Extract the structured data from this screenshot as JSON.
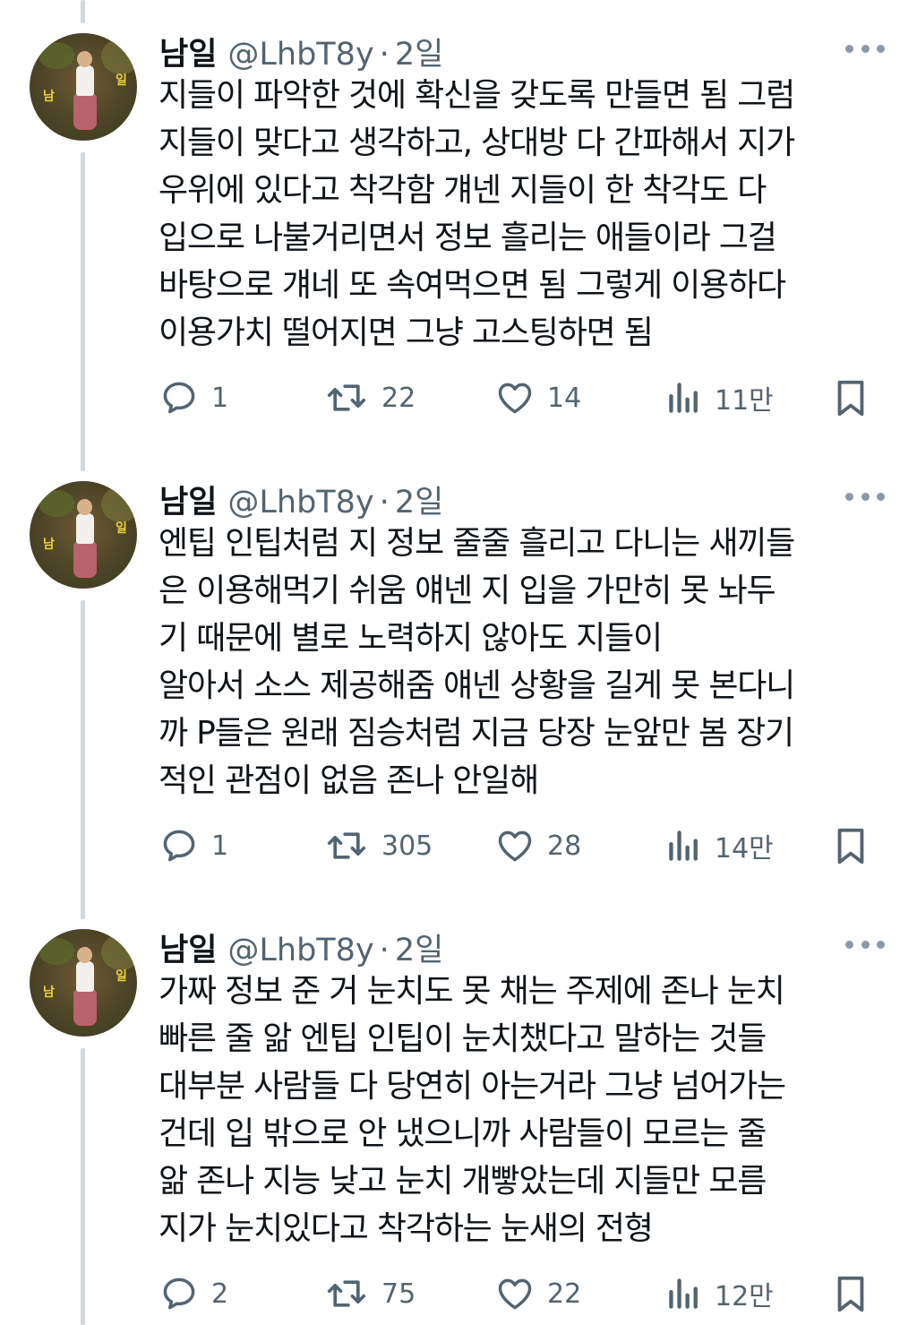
{
  "tweets": [
    {
      "author": "남일",
      "handle": "@LhbT8y",
      "separator": "·",
      "time": "2일",
      "lines": [
        "지들이 파악한 것에 확신을 갖도록 만들면 됨 그럼",
        "지들이 맞다고 생각하고, 상대방 다 간파해서 지가",
        "우위에 있다고 착각함 걔넨 지들이 한 착각도 다",
        "입으로 나불거리면서 정보 흘리는 애들이라 그걸",
        "바탕으로 걔네 또 속여먹으면 됨 그렇게 이용하다",
        "이용가치 떨어지면 그냥 고스팅하면 됨"
      ],
      "replies": "1",
      "retweets": "22",
      "likes": "14",
      "views": "11만"
    },
    {
      "author": "남일",
      "handle": "@LhbT8y",
      "separator": "·",
      "time": "2일",
      "lines": [
        "엔팁 인팁처럼 지 정보 줄줄 흘리고 다니는 새끼들",
        "은 이용해먹기 쉬움 얘넨 지 입을 가만히 못 놔두",
        "기 때문에 별로 노력하지 않아도 지들이",
        "알아서 소스 제공해줌 얘넨 상황을 길게 못 본다니",
        "까 P들은 원래 짐승처럼 지금 당장 눈앞만 봄 장기",
        "적인 관점이 없음 존나 안일해"
      ],
      "replies": "1",
      "retweets": "305",
      "likes": "28",
      "views": "14만"
    },
    {
      "author": "남일",
      "handle": "@LhbT8y",
      "separator": "·",
      "time": "2일",
      "lines": [
        "가짜 정보 준 거 눈치도 못 채는 주제에 존나 눈치",
        "빠른 줄 앎 엔팁 인팁이 눈치챘다고 말하는 것들",
        "대부분 사람들 다 당연히 아는거라 그냥 넘어가는",
        "건데 입 밖으로 안 냈으니까 사람들이 모르는 줄",
        "앎 존나 지능 낮고 눈치 개빻았는데 지들만 모름",
        "지가 눈치있다고 착각하는 눈새의 전형"
      ],
      "replies": "2",
      "retweets": "75",
      "likes": "22",
      "views": "12만"
    }
  ],
  "avatar_caption_left": "남",
  "avatar_caption_right": "일",
  "icons": {
    "reply": "reply-icon",
    "retweet": "retweet-icon",
    "like": "heart-icon",
    "views": "views-icon",
    "bookmark": "bookmark-icon",
    "more": "more-icon"
  },
  "colors": {
    "text": "#0f1419",
    "secondary": "#536471",
    "thread_line": "#cfd9de"
  }
}
